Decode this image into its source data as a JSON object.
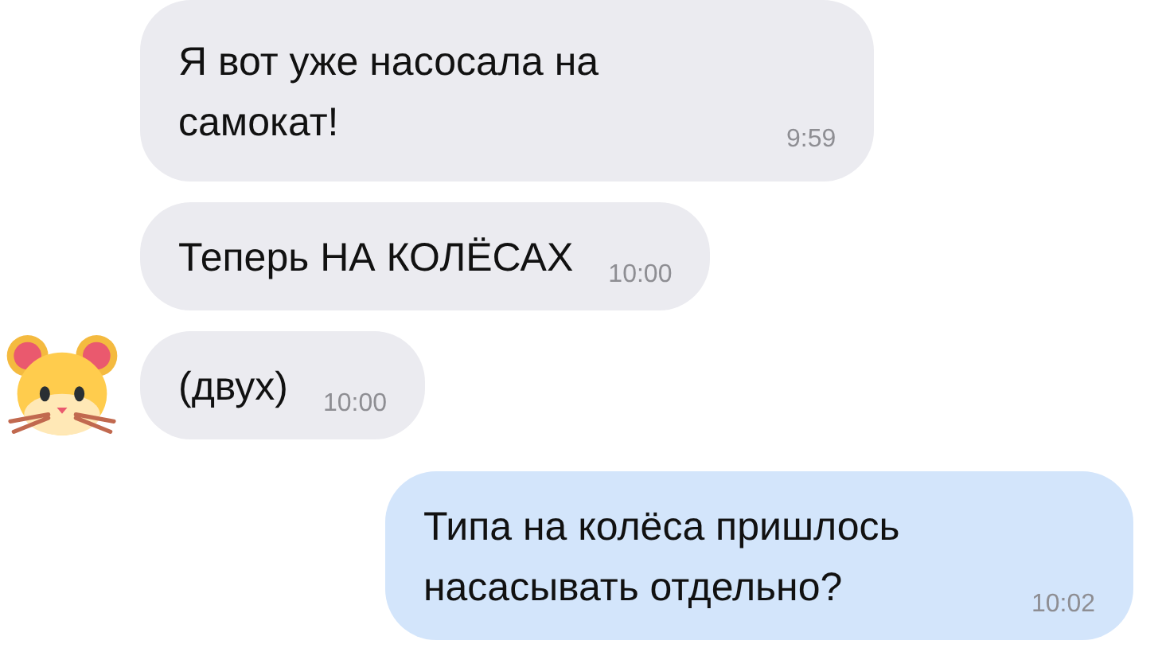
{
  "messages": [
    {
      "kind": "incoming",
      "text": "Я вот уже насосала на самокат!",
      "time": "9:59",
      "avatar": false
    },
    {
      "kind": "incoming",
      "text": "Теперь НА КОЛЁСАХ",
      "time": "10:00",
      "avatar": false
    },
    {
      "kind": "incoming",
      "text": "(двух)",
      "time": "10:00",
      "avatar": true
    },
    {
      "kind": "outgoing",
      "text": "Типа на колёса пришлось насасывать отдельно?",
      "time": "10:02",
      "avatar": false
    }
  ]
}
